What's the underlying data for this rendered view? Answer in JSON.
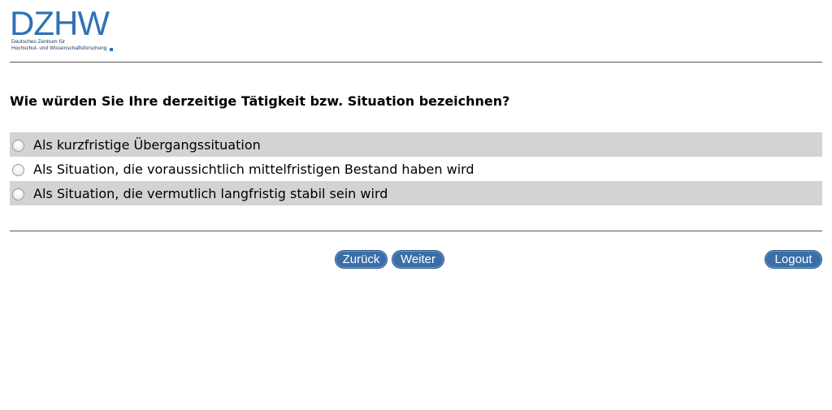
{
  "logo": {
    "mark": "DZHW",
    "line1": "Deutsches Zentrum für",
    "line2": "Hochschul- und Wissenschaftsforschung",
    "color": "#2e72b5"
  },
  "question": "Wie würden Sie Ihre derzeitige Tätigkeit bzw. Situation bezeichnen?",
  "options": [
    {
      "label": "Als kurzfristige Übergangssituation",
      "selected": false
    },
    {
      "label": "Als Situation, die voraussichtlich mittelfristigen Bestand haben wird",
      "selected": false
    },
    {
      "label": "Als Situation, die vermutlich langfristig stabil sein wird",
      "selected": false
    }
  ],
  "nav": {
    "back_label": "Zurück",
    "next_label": "Weiter",
    "logout_label": "Logout",
    "button_color": "#3a6ea8"
  },
  "colors": {
    "row_shade": "#d3d3d3"
  }
}
